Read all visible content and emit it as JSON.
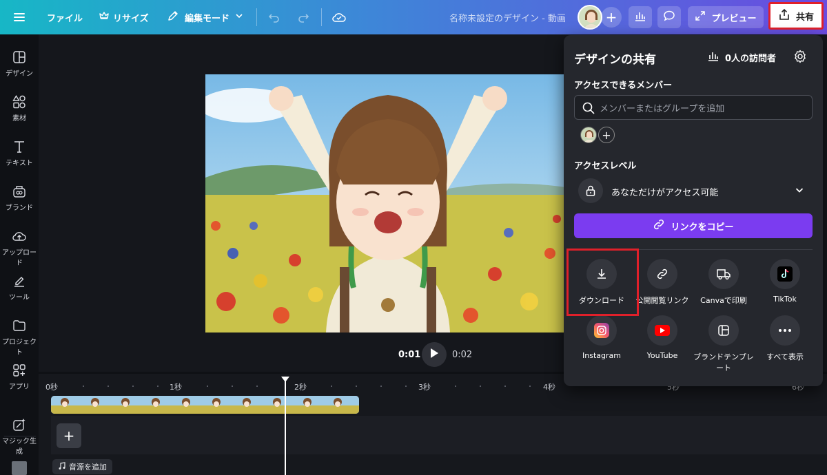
{
  "topbar": {
    "file": "ファイル",
    "resize": "リサイズ",
    "edit_mode": "編集モード",
    "design_name": "名称未設定のデザイン - 動画",
    "preview": "プレビュー",
    "share": "共有"
  },
  "sidebar": {
    "items": [
      {
        "label": "デザイン",
        "icon": "layout-icon"
      },
      {
        "label": "素材",
        "icon": "elements-icon"
      },
      {
        "label": "テキスト",
        "icon": "text-icon"
      },
      {
        "label": "ブランド",
        "icon": "brand-icon"
      },
      {
        "label": "アップロード",
        "icon": "upload-icon"
      },
      {
        "label": "ツール",
        "icon": "draw-icon"
      },
      {
        "label": "プロジェクト",
        "icon": "folder-icon"
      },
      {
        "label": "アプリ",
        "icon": "apps-icon"
      },
      {
        "label": "マジック生成",
        "icon": "magic-icon"
      }
    ]
  },
  "player": {
    "current": "0:01",
    "total": "0:02"
  },
  "timeline": {
    "ticks": [
      "0秒",
      "1秒",
      "2秒",
      "3秒",
      "4秒",
      "5秒",
      "6秒"
    ],
    "add_audio": "音源を追加"
  },
  "share_panel": {
    "title": "デザインの共有",
    "visitors": "0人の訪問者",
    "members_label": "アクセスできるメンバー",
    "search_placeholder": "メンバーまたはグループを追加",
    "access_level_label": "アクセスレベル",
    "access_level_value": "あなただけがアクセス可能",
    "copy_link": "リンクをコピー",
    "options": [
      {
        "label": "ダウンロード",
        "icon": "download-icon"
      },
      {
        "label": "公開閲覧リンク",
        "icon": "link-icon"
      },
      {
        "label": "Canvaで印刷",
        "icon": "truck-icon"
      },
      {
        "label": "TikTok",
        "icon": "tiktok-icon"
      },
      {
        "label": "Instagram",
        "icon": "instagram-icon"
      },
      {
        "label": "YouTube",
        "icon": "youtube-icon"
      },
      {
        "label": "ブランドテンプレート",
        "icon": "template-icon"
      },
      {
        "label": "すべて表示",
        "icon": "more-icon"
      }
    ]
  },
  "colors": {
    "accent_purple": "#7b3cf0",
    "highlight_red": "#e0202a",
    "panel_bg": "#25272d"
  }
}
